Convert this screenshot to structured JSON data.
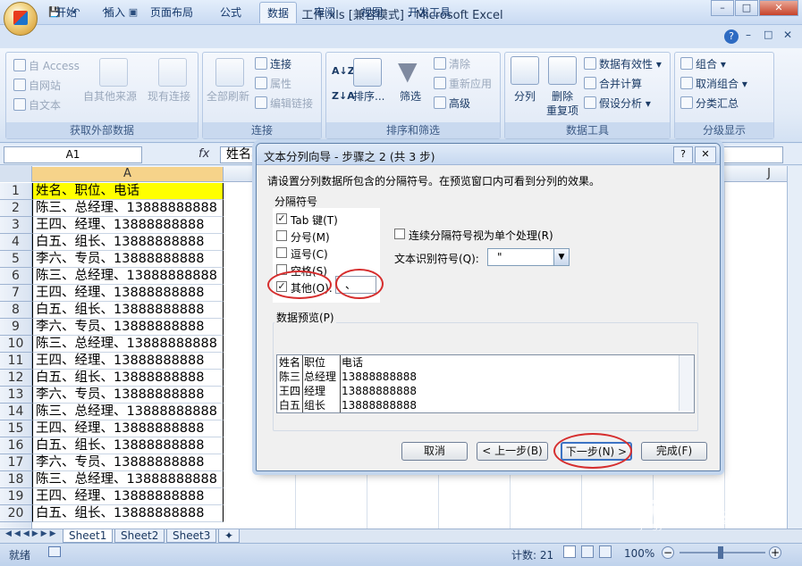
{
  "window": {
    "title": "工作.xls  [兼容模式] - Microsoft Excel"
  },
  "quick_access": [
    "save-icon",
    "undo-icon",
    "redo-icon",
    "print-preview-icon"
  ],
  "tabs": [
    "开始",
    "插入",
    "页面布局",
    "公式",
    "数据",
    "审阅",
    "视图",
    "开发工具"
  ],
  "active_tab": "数据",
  "ribbon": {
    "get_external": {
      "label": "获取外部数据",
      "access": "自 Access",
      "web": "自网站",
      "text": "自文本",
      "other": "自其他来源",
      "existing": "现有连接"
    },
    "connections": {
      "label": "连接",
      "refresh_all": "全部刷新",
      "connections": "连接",
      "properties": "属性",
      "edit_links": "编辑链接"
    },
    "sort_filter": {
      "label": "排序和筛选",
      "sort": "排序...",
      "filter": "筛选",
      "clear": "清除",
      "reapply": "重新应用",
      "advanced": "高级"
    },
    "data_tools": {
      "label": "数据工具",
      "text_to_columns": "分列",
      "remove_dup_1": "删除",
      "remove_dup_2": "重复项",
      "validation": "数据有效性",
      "consolidate": "合并计算",
      "what_if": "假设分析"
    },
    "outline": {
      "label": "分级显示",
      "group": "组合",
      "ungroup": "取消组合",
      "subtotal": "分类汇总"
    }
  },
  "formula_bar": {
    "name_box": "A1",
    "fx": "fx",
    "content": "姓名、"
  },
  "columns": {
    "A": "A",
    "J": "J"
  },
  "rows": [
    {
      "n": "1",
      "a": "姓名、职位、电话"
    },
    {
      "n": "2",
      "a": "陈三、总经理、13888888888"
    },
    {
      "n": "3",
      "a": "王四、经理、13888888888"
    },
    {
      "n": "4",
      "a": "白五、组长、13888888888"
    },
    {
      "n": "5",
      "a": "李六、专员、13888888888"
    },
    {
      "n": "6",
      "a": "陈三、总经理、13888888888"
    },
    {
      "n": "7",
      "a": "王四、经理、13888888888"
    },
    {
      "n": "8",
      "a": "白五、组长、13888888888"
    },
    {
      "n": "9",
      "a": "李六、专员、13888888888"
    },
    {
      "n": "10",
      "a": "陈三、总经理、13888888888"
    },
    {
      "n": "11",
      "a": "王四、经理、13888888888"
    },
    {
      "n": "12",
      "a": "白五、组长、13888888888"
    },
    {
      "n": "13",
      "a": "李六、专员、13888888888"
    },
    {
      "n": "14",
      "a": "陈三、总经理、13888888888"
    },
    {
      "n": "15",
      "a": "王四、经理、13888888888"
    },
    {
      "n": "16",
      "a": "白五、组长、13888888888"
    },
    {
      "n": "17",
      "a": "李六、专员、13888888888"
    },
    {
      "n": "18",
      "a": "陈三、总经理、13888888888"
    },
    {
      "n": "19",
      "a": "王四、经理、13888888888"
    },
    {
      "n": "20",
      "a": "白五、组长、13888888888"
    }
  ],
  "sheets": [
    "Sheet1",
    "Sheet2",
    "Sheet3"
  ],
  "status": {
    "ready": "就绪",
    "count": "计数: 21",
    "zoom": "100%"
  },
  "dialog": {
    "title": "文本分列向导 - 步骤之 2 (共 3 步)",
    "instruction": "请设置分列数据所包含的分隔符号。在预览窗口内可看到分列的效果。",
    "delimiters_label": "分隔符号",
    "delimiters": [
      {
        "label": "Tab 键(T)",
        "checked": true
      },
      {
        "label": "分号(M)",
        "checked": false
      },
      {
        "label": "逗号(C)",
        "checked": false
      },
      {
        "label": "空格(S)",
        "checked": false
      },
      {
        "label": "其他(O):",
        "checked": true
      }
    ],
    "other_value": "、",
    "consecutive_label": "连续分隔符号视为单个处理(R)",
    "consecutive_checked": false,
    "qualifier_label": "文本识别符号(Q):",
    "qualifier_value": "\"",
    "preview_label": "数据预览(P)",
    "preview_rows": [
      [
        "姓名",
        "职位",
        "电话"
      ],
      [
        "陈三",
        "总经理",
        "13888888888"
      ],
      [
        "王四",
        "经理",
        "13888888888"
      ],
      [
        "白五",
        "组长",
        "13888888888"
      ]
    ],
    "buttons": {
      "cancel": "取消",
      "back": "< 上一步(B)",
      "next": "下一步(N) >",
      "finish": "完成(F)"
    }
  },
  "watermark": {
    "main": "Baidu经验",
    "sub": "jingyan.baidu.com"
  },
  "colors": {
    "header_fill": "#ffff00",
    "annotation": "#d62e2e",
    "ribbon_bg": "#dfe8f5"
  }
}
